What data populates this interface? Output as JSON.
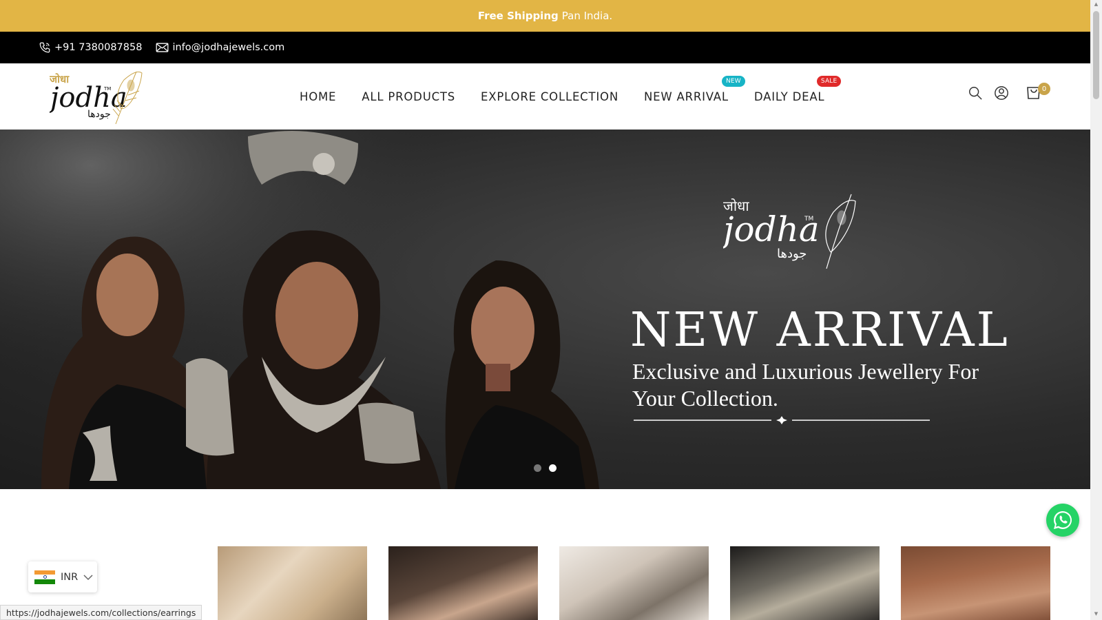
{
  "announcement": {
    "bold": "Free Shipping",
    "rest": "Pan India."
  },
  "contact": {
    "phone": "+91 7380087858",
    "email": "info@jodhajewels.com"
  },
  "logo": {
    "hindi": "जोधा",
    "brand": "jodha",
    "tm": "TM",
    "urdu": "جودھا"
  },
  "nav": {
    "home": "HOME",
    "all_products": "ALL PRODUCTS",
    "explore_collection": "EXPLORE COLLECTION",
    "new_arrival": "NEW ARRIVAL",
    "new_badge": "NEW",
    "daily_deal": "DAILY DEAL",
    "sale_badge": "SALE"
  },
  "header_icons": [
    "search-icon",
    "account-icon",
    "cart-icon"
  ],
  "cart": {
    "count": "0"
  },
  "hero": {
    "title": "NEW ARRIVAL",
    "subtitle": "Exclusive and Luxurious Jewellery For Your Collection.",
    "slides": 2,
    "active_slide": 2
  },
  "products": [
    "product-1",
    "product-2",
    "product-3",
    "product-4",
    "product-5"
  ],
  "currency": {
    "code": "INR"
  },
  "status_url": "https://jodhajewels.com/collections/earrings",
  "colors": {
    "announcement": "#e2b545",
    "new_badge": "#17b4c6",
    "sale_badge": "#e02a2a",
    "whatsapp": "#25d366"
  }
}
